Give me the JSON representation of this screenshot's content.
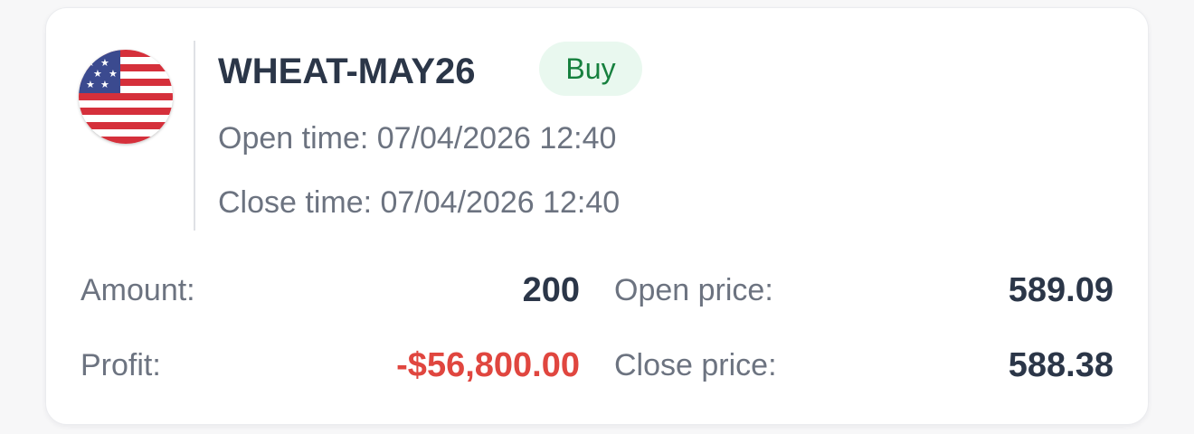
{
  "position": {
    "flag_icon": "us-flag-icon",
    "symbol": "WHEAT-MAY26",
    "side": "Buy",
    "open_time": "Open time: 07/04/2026 12:40",
    "close_time": "Close time: 07/04/2026 12:40"
  },
  "details": {
    "amount_label": "Amount:",
    "amount_value": "200",
    "profit_label": "Profit:",
    "profit_value": "-$56,800.00",
    "open_price_label": "Open price:",
    "open_price_value": "589.09",
    "close_price_label": "Close price:",
    "close_price_value": "588.38"
  },
  "colors": {
    "buy_badge_bg": "#e9f8ef",
    "buy_badge_text": "#16803e",
    "negative_profit": "#e0463f",
    "value_text": "#2b3648",
    "label_text": "#6c7380"
  }
}
